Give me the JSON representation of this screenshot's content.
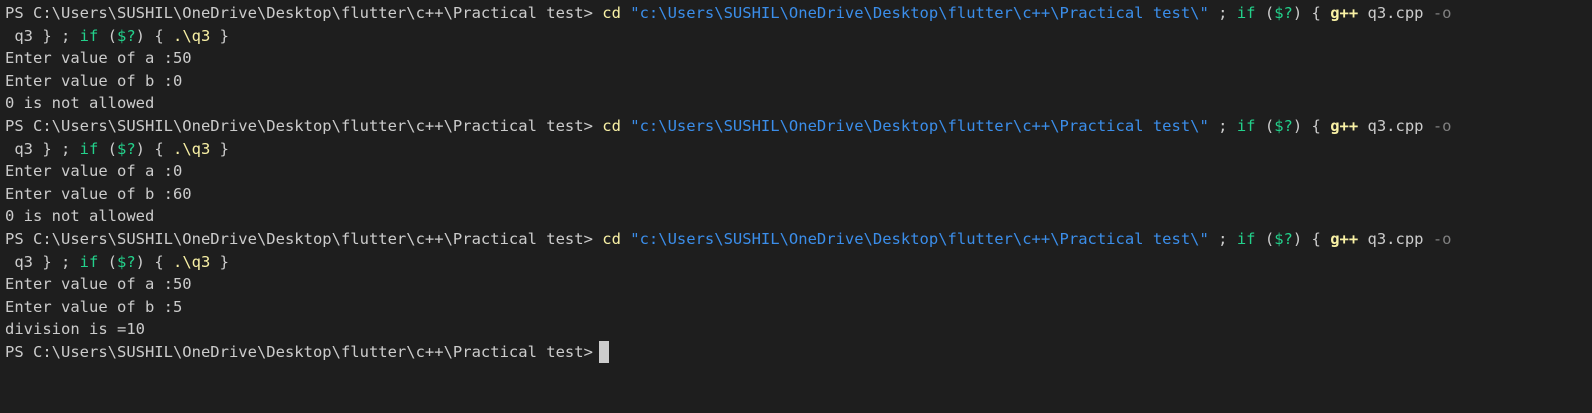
{
  "terminal": {
    "prompt": "PS C:\\Users\\SUSHIL\\OneDrive\\Desktop\\flutter\\c++\\Practical test>",
    "command": {
      "cd": "cd",
      "path": "\"c:\\Users\\SUSHIL\\OneDrive\\Desktop\\flutter\\c++\\Practical test\\\"",
      "sep1": " ; ",
      "if1": "if",
      "cond1_open": " (",
      "cond1": "$?",
      "cond1_close": ") { ",
      "gpp": "g++",
      "src": " q3.cpp ",
      "flag": "-o",
      "wrap_out": " q3 } ; ",
      "if2": "if",
      "cond2_open": " (",
      "cond2": "$?",
      "cond2_close": ") { ",
      "exe": ".\\q3",
      "end": " }"
    },
    "runs": [
      {
        "output": [
          "Enter value of a :50",
          "Enter value of b :0",
          "0 is not allowed"
        ]
      },
      {
        "output": [
          "Enter value of a :0",
          "Enter value of b :60",
          "0 is not allowed"
        ]
      },
      {
        "output": [
          "Enter value of a :50",
          "Enter value of b :5",
          "division is =10"
        ]
      }
    ]
  },
  "colors": {
    "background": "#1e1e1e",
    "text": "#cccccc",
    "command_yellow": "#f9f1a5",
    "string_blue": "#3b8eea",
    "keyword_green": "#23d18b",
    "flag_gray": "#808080"
  }
}
